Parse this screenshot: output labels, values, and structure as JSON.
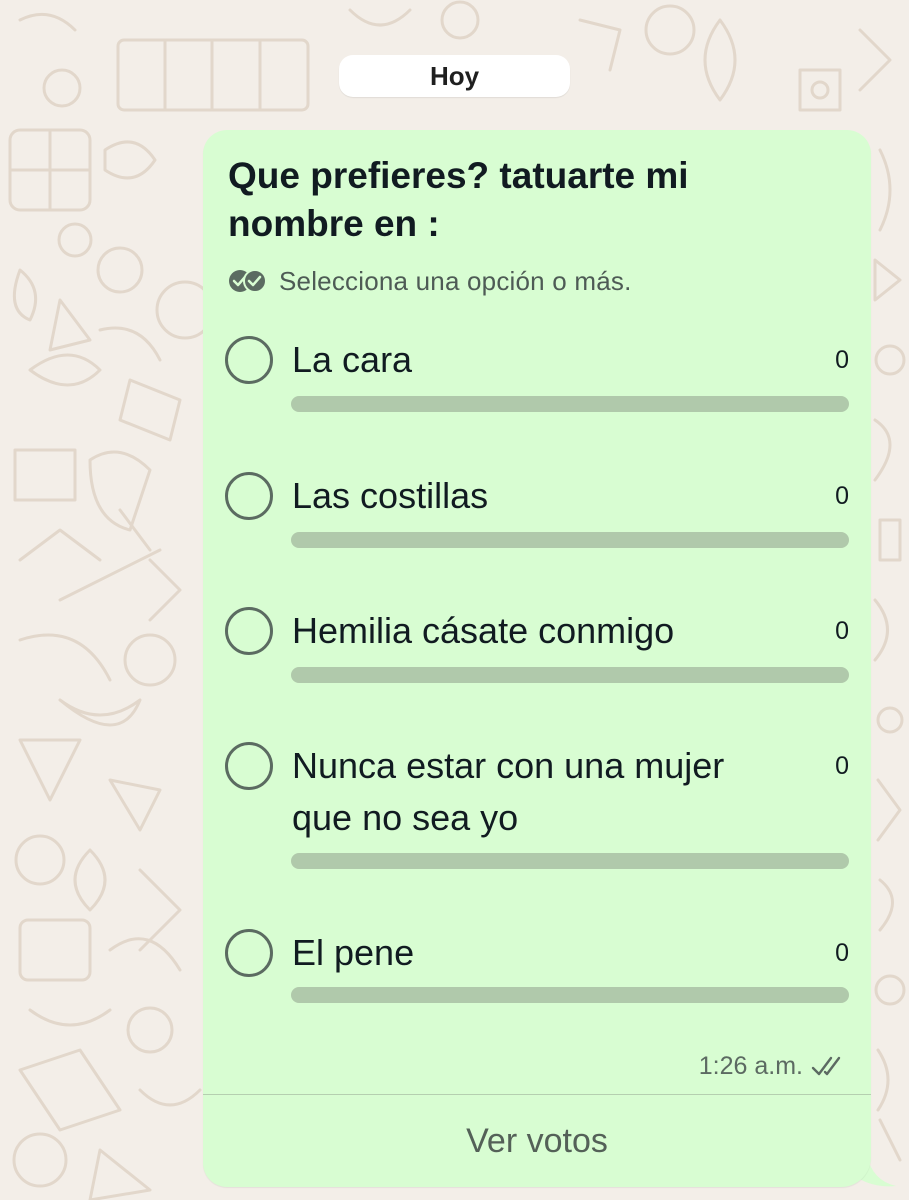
{
  "date_chip": {
    "label": "Hoy"
  },
  "poll": {
    "question": "Que prefieres? tatuarte mi nombre en :",
    "hint": "Selecciona una opción o más.",
    "hint_icon": "multi-check-icon",
    "options": [
      {
        "label": "La cara",
        "votes": "0",
        "fill": 0
      },
      {
        "label": "Las costillas",
        "votes": "0",
        "fill": 0
      },
      {
        "label": "Hemilia cásate conmigo",
        "votes": "0",
        "fill": 0
      },
      {
        "label": "Nunca estar con una mujer que no sea yo",
        "votes": "0",
        "fill": 0
      },
      {
        "label": "El pene",
        "votes": "0",
        "fill": 0
      }
    ],
    "time": "1:26 a.m.",
    "status_icon": "double-check-icon",
    "view_votes_label": "Ver votos"
  },
  "colors": {
    "wallpaper": "#f3eee8",
    "bubble": "#d8fdd2",
    "bar_track": "#b0c9ab",
    "radio_border": "#5b6b61",
    "secondary_text": "#5c6a62"
  }
}
